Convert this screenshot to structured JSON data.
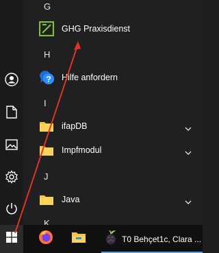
{
  "left_rail": {
    "items": [
      {
        "icon": "user-icon"
      },
      {
        "icon": "document-icon"
      },
      {
        "icon": "pictures-icon"
      },
      {
        "icon": "settings-gear-icon"
      },
      {
        "icon": "power-icon"
      }
    ]
  },
  "app_list": {
    "letters": {
      "g": "G",
      "h": "H",
      "i": "I",
      "j": "J",
      "k": "K"
    },
    "entries": {
      "ghg": {
        "label": "GHG Praxisdienst",
        "icon": "ghg-logo-icon"
      },
      "hilfe": {
        "label": "Hilfe anfordern",
        "icon": "help-bubble-icon"
      },
      "ifapdb": {
        "label": "ifapDB",
        "icon": "folder-icon"
      },
      "impfmodul": {
        "label": "Impfmodul",
        "icon": "folder-icon"
      },
      "java": {
        "label": "Java",
        "icon": "folder-icon"
      }
    }
  },
  "taskbar": {
    "start_icon": "windows-logo-icon",
    "items": [
      {
        "icon": "firefox-icon"
      },
      {
        "icon": "file-explorer-icon"
      },
      {
        "icon": "tor-berry-icon",
        "label": "T0 Behçet1c, Clara ..."
      }
    ]
  },
  "colors": {
    "accent_green": "#7fbf3f",
    "folder_yellow": "#f5c542",
    "annotation_red": "#e0312b",
    "taskbar_highlight": "#5aa0e0"
  }
}
